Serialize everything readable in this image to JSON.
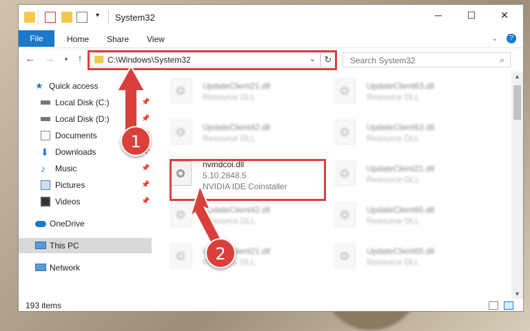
{
  "window": {
    "title": "System32"
  },
  "ribbon": {
    "tabs": [
      "File",
      "Home",
      "Share",
      "View"
    ]
  },
  "address": {
    "path": "C:\\Windows\\System32"
  },
  "search": {
    "placeholder": "Search System32"
  },
  "sidebar": {
    "quick_access": "Quick access",
    "items": [
      "Local Disk (C:)",
      "Local Disk (D:)",
      "Documents",
      "Downloads",
      "Music",
      "Pictures",
      "Videos"
    ],
    "onedrive": "OneDrive",
    "this_pc": "This PC",
    "network": "Network"
  },
  "files": {
    "left": [
      {
        "name": "UpdateClient21.dll",
        "desc": "Resource DLL"
      },
      {
        "name": "UpdateClient42.dll",
        "desc": "Resource DLL"
      },
      {
        "name": "nvmdcoi.dll",
        "version": "5.10.2848.5",
        "desc": "NVIDIA IDE Coinstaller"
      },
      {
        "name": "UpdateClient42.dll",
        "desc": "Resource DLL"
      },
      {
        "name": "UpdateClient21.dll",
        "desc": "Resource DLL"
      }
    ],
    "right": [
      {
        "name": "UpdateClient63.dll",
        "desc": "Resource DLL"
      },
      {
        "name": "UpdateClient63.dll",
        "desc": "Resource DLL"
      },
      {
        "name": "UpdateClient21.dll",
        "desc": "Resource DLL"
      },
      {
        "name": "UpdateClient65.dll",
        "desc": "Resource DLL"
      },
      {
        "name": "UpdateClient65.dll",
        "desc": "Resource DLL"
      }
    ]
  },
  "status": {
    "count": "193 items"
  },
  "callouts": [
    "1",
    "2"
  ],
  "colors": {
    "accent": "#1979ca",
    "highlight": "#d9403c"
  }
}
